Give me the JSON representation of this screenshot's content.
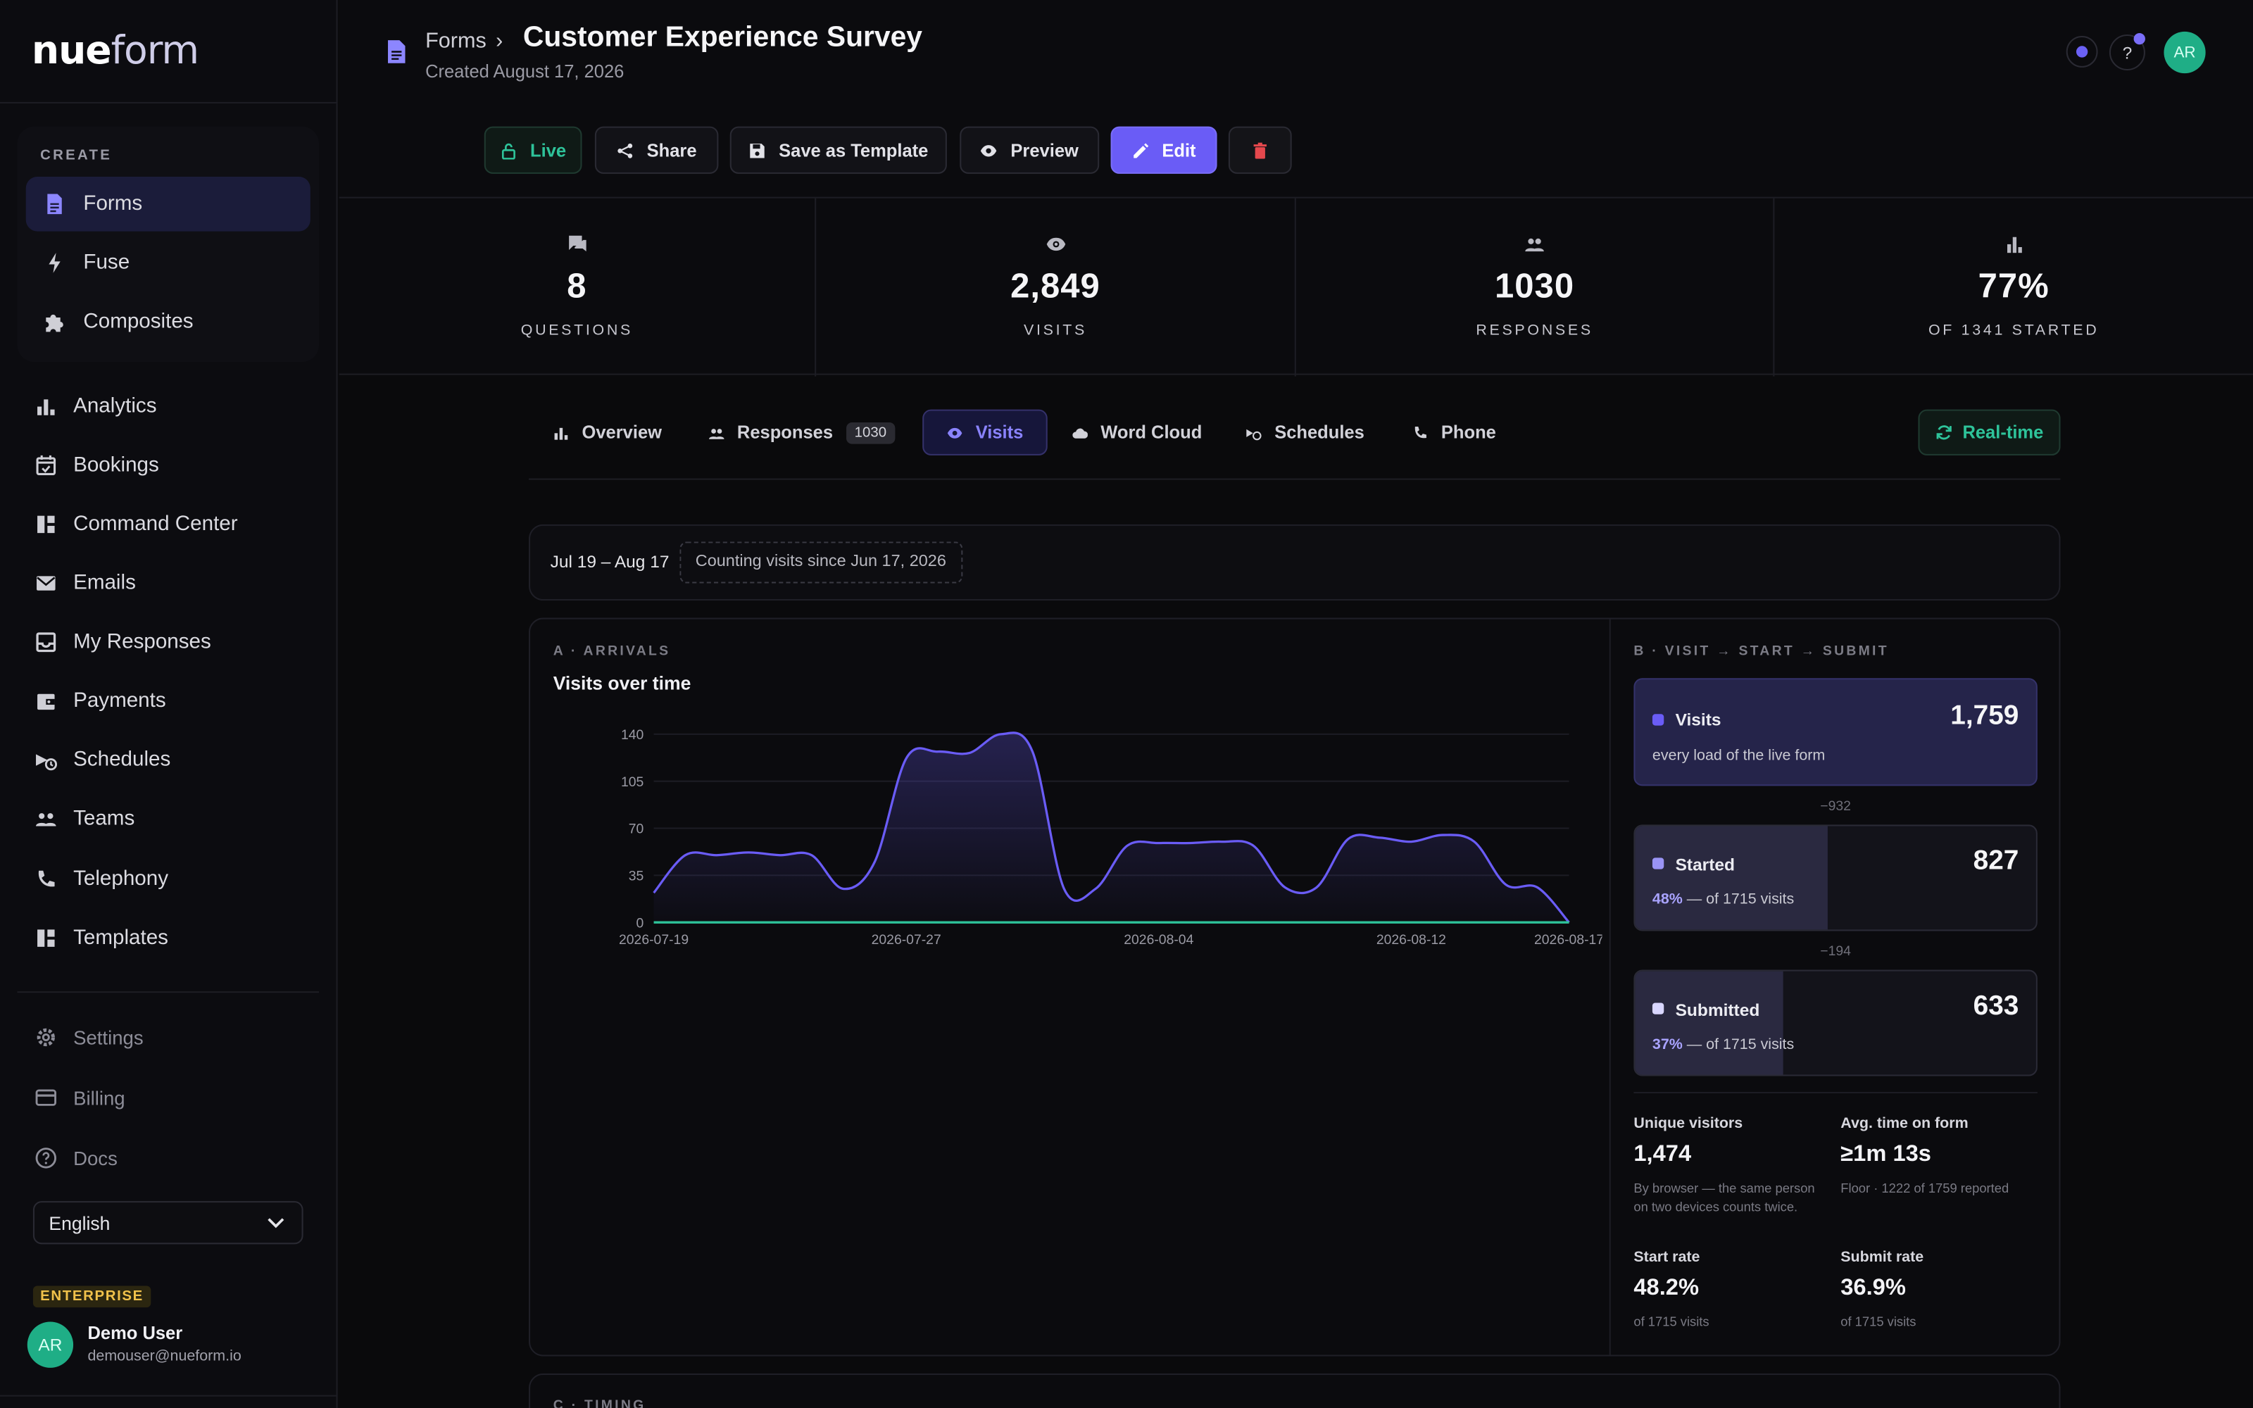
{
  "app": {
    "logo_main": "nue",
    "logo_light": "form"
  },
  "sidebar": {
    "create_label": "CREATE",
    "create_items": [
      {
        "label": "Forms",
        "icon": "doc-icon",
        "active": true
      },
      {
        "label": "Fuse",
        "icon": "bolt-icon"
      },
      {
        "label": "Composites",
        "icon": "puzzle-icon"
      }
    ],
    "main_items": [
      {
        "label": "Analytics",
        "icon": "bar-chart-icon"
      },
      {
        "label": "Bookings",
        "icon": "calendar-check-icon"
      },
      {
        "label": "Command Center",
        "icon": "dashboard-icon"
      },
      {
        "label": "Emails",
        "icon": "mail-icon"
      },
      {
        "label": "My Responses",
        "icon": "inbox-icon"
      },
      {
        "label": "Payments",
        "icon": "wallet-icon"
      },
      {
        "label": "Schedules",
        "icon": "schedule-icon"
      },
      {
        "label": "Teams",
        "icon": "people-icon"
      },
      {
        "label": "Telephony",
        "icon": "phone-icon"
      },
      {
        "label": "Templates",
        "icon": "grid-icon"
      }
    ],
    "secondary_items": [
      {
        "label": "Settings",
        "icon": "gear-icon"
      },
      {
        "label": "Billing",
        "icon": "card-icon"
      },
      {
        "label": "Docs",
        "icon": "help-circle-icon"
      }
    ],
    "language": "English",
    "plan_badge": "ENTERPRISE",
    "user": {
      "initials": "AR",
      "name": "Demo User",
      "email": "demouser@nueform.io"
    }
  },
  "header": {
    "breadcrumb": "Forms",
    "breadcrumb_sep": "›",
    "title": "Customer Experience Survey",
    "created": "Created August 17, 2026",
    "help": "?",
    "avatar": "AR"
  },
  "actions": {
    "live": "Live",
    "share": "Share",
    "save_template": "Save as Template",
    "preview": "Preview",
    "edit": "Edit"
  },
  "stats": [
    {
      "value": "8",
      "label": "QUESTIONS",
      "icon": "chat-icon"
    },
    {
      "value": "2,849",
      "label": "VISITS",
      "icon": "eye-icon"
    },
    {
      "value": "1030",
      "label": "RESPONSES",
      "icon": "people-icon"
    },
    {
      "value": "77%",
      "label": "OF 1341 STARTED",
      "icon": "bar-chart-icon"
    }
  ],
  "tabs": [
    {
      "label": "Overview",
      "icon": "bar-chart-icon"
    },
    {
      "label": "Responses",
      "icon": "people-icon",
      "count": "1030"
    },
    {
      "label": "Visits",
      "icon": "eye-icon",
      "active": true
    },
    {
      "label": "Word Cloud",
      "icon": "cloud-icon"
    },
    {
      "label": "Schedules",
      "icon": "schedule-icon"
    },
    {
      "label": "Phone",
      "icon": "phone-icon"
    }
  ],
  "realtime": "Real-time",
  "filter": {
    "date_range": "Jul 19 – Aug 17",
    "counting": "Counting visits since Jun 17, 2026"
  },
  "arrivals": {
    "section": "A · ARRIVALS",
    "title": "Visits over time"
  },
  "chart_data": {
    "type": "area",
    "title": "Visits over time",
    "x_ticks": [
      "2026-07-19",
      "2026-07-27",
      "2026-08-04",
      "2026-08-12",
      "2026-08-17"
    ],
    "y_ticks": [
      0,
      35,
      70,
      105,
      140
    ],
    "ylim": [
      0,
      140
    ],
    "grid": true,
    "x": [
      "2026-07-19",
      "2026-07-20",
      "2026-07-21",
      "2026-07-22",
      "2026-07-23",
      "2026-07-24",
      "2026-07-25",
      "2026-07-26",
      "2026-07-27",
      "2026-07-28",
      "2026-07-29",
      "2026-07-30",
      "2026-07-31",
      "2026-08-01",
      "2026-08-02",
      "2026-08-03",
      "2026-08-04",
      "2026-08-05",
      "2026-08-06",
      "2026-08-07",
      "2026-08-08",
      "2026-08-09",
      "2026-08-10",
      "2026-08-11",
      "2026-08-12",
      "2026-08-13",
      "2026-08-14",
      "2026-08-15",
      "2026-08-16",
      "2026-08-17"
    ],
    "series": [
      {
        "values": [
          22,
          50,
          50,
          52,
          50,
          50,
          25,
          45,
          122,
          127,
          126,
          140,
          127,
          25,
          25,
          57,
          59,
          59,
          60,
          57,
          26,
          26,
          62,
          63,
          60,
          65,
          60,
          28,
          26,
          0
        ]
      },
      {
        "values": [
          0,
          0,
          0,
          0,
          0,
          0,
          0,
          0,
          0,
          0,
          0,
          0,
          0,
          0,
          0,
          0,
          0,
          0,
          0,
          0,
          0,
          0,
          0,
          0,
          0,
          0,
          0,
          0,
          0,
          0
        ]
      }
    ],
    "colors": [
      "#6a5cf6",
      "#2ec39a"
    ]
  },
  "funnel": {
    "section": "B · VISIT → START → SUBMIT",
    "visits": {
      "label": "Visits",
      "value": "1,759",
      "sub": "every load of the live form"
    },
    "drop1": "−932",
    "started": {
      "label": "Started",
      "value": "827",
      "pct": "48%",
      "sub": " — of 1715 visits",
      "fraction": 0.48
    },
    "drop2": "−194",
    "submitted": {
      "label": "Submitted",
      "value": "633",
      "pct": "37%",
      "sub": " — of 1715 visits",
      "fraction": 0.37
    }
  },
  "metrics": {
    "unique_label": "Unique visitors",
    "unique_value": "1,474",
    "unique_sub": "By browser — the same person on two devices counts twice.",
    "avg_label": "Avg. time on form",
    "avg_value": "≥1m 13s",
    "avg_sub": "Floor · 1222 of 1759 reported",
    "start_label": "Start rate",
    "start_value": "48.2%",
    "start_sub": "of 1715 visits",
    "submit_label": "Submit rate",
    "submit_value": "36.9%",
    "submit_sub": "of 1715 visits"
  },
  "timing": {
    "section": "C · TIMING"
  },
  "colors": {
    "accent": "#6a5cf6",
    "green": "#2ec39a",
    "danger": "#e5484d",
    "enterprise": "#f0c14b"
  }
}
